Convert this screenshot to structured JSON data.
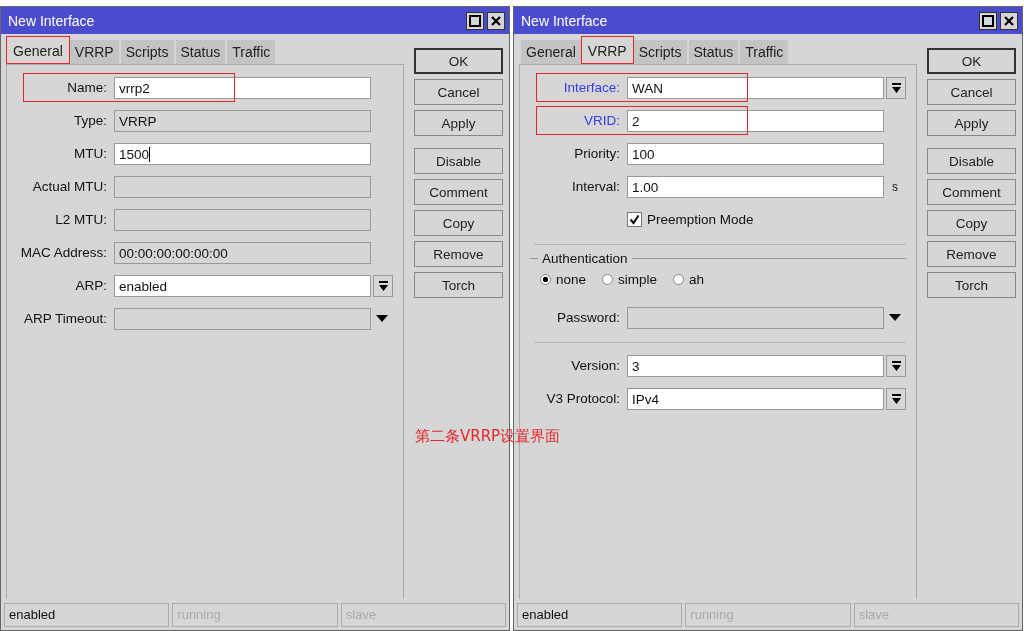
{
  "windows": [
    {
      "title": "New Interface",
      "tabs": [
        {
          "label": "General",
          "selected": true,
          "highlighted": true
        },
        {
          "label": "VRRP",
          "selected": false,
          "highlighted": false
        },
        {
          "label": "Scripts",
          "selected": false,
          "highlighted": false
        },
        {
          "label": "Status",
          "selected": false,
          "highlighted": false
        },
        {
          "label": "Traffic",
          "selected": false,
          "highlighted": false
        }
      ],
      "fields": [
        {
          "kind": "text",
          "label": "Name:",
          "value": "vrrp2",
          "highlighted": true,
          "required": false
        },
        {
          "kind": "readonly",
          "label": "Type:",
          "value": "VRRP",
          "highlighted": false,
          "required": false
        },
        {
          "kind": "text",
          "label": "MTU:",
          "value": "1500",
          "highlighted": false,
          "required": false,
          "cursor": true
        },
        {
          "kind": "readonly",
          "label": "Actual MTU:",
          "highlighted": false,
          "required": false
        },
        {
          "kind": "readonly",
          "label": "L2 MTU:",
          "highlighted": false,
          "required": false
        },
        {
          "kind": "readonly",
          "label": "MAC Address:",
          "value": "00:00:00:00:00:00",
          "highlighted": false,
          "required": false
        },
        {
          "kind": "dropdown",
          "label": "ARP:",
          "value": "enabled",
          "highlighted": false,
          "required": false
        },
        {
          "kind": "dropdown-disabled",
          "label": "ARP Timeout:",
          "highlighted": false,
          "required": false
        }
      ],
      "buttons": [
        [
          "OK",
          "Cancel",
          "Apply"
        ],
        [
          "Disable",
          "Comment",
          "Copy",
          "Remove",
          "Torch"
        ]
      ],
      "status": [
        {
          "text": "enabled",
          "active": true
        },
        {
          "text": "running",
          "active": false
        },
        {
          "text": "slave",
          "active": false
        }
      ]
    },
    {
      "title": "New Interface",
      "tabs": [
        {
          "label": "General",
          "selected": false,
          "highlighted": false
        },
        {
          "label": "VRRP",
          "selected": true,
          "highlighted": true
        },
        {
          "label": "Scripts",
          "selected": false,
          "highlighted": false
        },
        {
          "label": "Status",
          "selected": false,
          "highlighted": false
        },
        {
          "label": "Traffic",
          "selected": false,
          "highlighted": false
        }
      ],
      "fields": [
        {
          "kind": "dropdown",
          "label": "Interface:",
          "value": "WAN",
          "highlighted": true,
          "required": true
        },
        {
          "kind": "text",
          "label": "VRID:",
          "value": "2",
          "highlighted": true,
          "required": true
        },
        {
          "kind": "text",
          "label": "Priority:",
          "value": "100",
          "highlighted": false,
          "required": false
        },
        {
          "kind": "text",
          "label": "Interval:",
          "value": "1.00",
          "unit": "s",
          "highlighted": false,
          "required": false
        },
        {
          "kind": "checkbox",
          "label": "Preemption Mode",
          "checked": true
        },
        {
          "kind": "divider"
        },
        {
          "kind": "section",
          "label": "Authentication"
        },
        {
          "kind": "radio",
          "options": [
            {
              "label": "none",
              "selected": true
            },
            {
              "label": "simple",
              "selected": false
            },
            {
              "label": "ah",
              "selected": false
            }
          ]
        },
        {
          "kind": "dropdown-disabled",
          "label": "Password:",
          "highlighted": false,
          "required": false
        },
        {
          "kind": "divider"
        },
        {
          "kind": "dropdown",
          "label": "Version:",
          "value": "3",
          "highlighted": false,
          "required": false
        },
        {
          "kind": "dropdown",
          "label": "V3 Protocol:",
          "value": "IPv4",
          "highlighted": false,
          "required": false
        }
      ],
      "buttons": [
        [
          "OK",
          "Cancel",
          "Apply"
        ],
        [
          "Disable",
          "Comment",
          "Copy",
          "Remove",
          "Torch"
        ]
      ],
      "status": [
        {
          "text": "enabled",
          "active": true
        },
        {
          "text": "running",
          "active": false
        },
        {
          "text": "slave",
          "active": false
        }
      ]
    }
  ],
  "caption": "第二条VRRP设置界面"
}
